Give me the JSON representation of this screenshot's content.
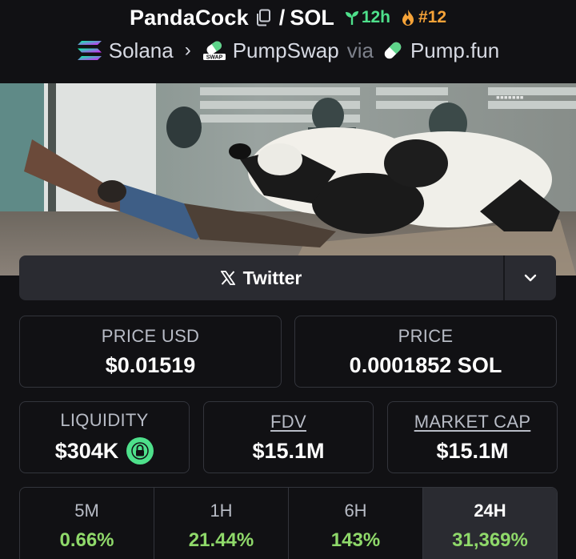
{
  "header": {
    "token_name": "PandaCock",
    "separator": "/",
    "pair": "SOL",
    "age": "12h",
    "rank": "#12",
    "colors": {
      "age": "#4ee08b",
      "rank": "#f6a338"
    },
    "breadcrumb": {
      "chain": "Solana",
      "chain_icon": "solana-icon",
      "dex": "PumpSwap",
      "dex_icon": "pumpswap-icon",
      "dex_icon_text": "SWAP",
      "via": "via",
      "launchpad": "Pump.fun",
      "launchpad_icon": "pill-icon"
    }
  },
  "twitter": {
    "label": "Twitter",
    "icon": "x-logo-icon",
    "dropdown_icon": "chevron-down-icon"
  },
  "stats": {
    "price_usd": {
      "label": "PRICE USD",
      "value": "$0.01519"
    },
    "price": {
      "label": "PRICE",
      "value": "0.0001852 SOL"
    },
    "liquidity": {
      "label": "LIQUIDITY",
      "value": "$304K",
      "icon": "lock-icon"
    },
    "fdv": {
      "label": "FDV",
      "value": "$15.1M"
    },
    "market_cap": {
      "label": "MARKET CAP",
      "value": "$15.1M"
    }
  },
  "changes": [
    {
      "period": "5M",
      "value": "0.66%"
    },
    {
      "period": "1H",
      "value": "21.44%"
    },
    {
      "period": "6H",
      "value": "143%"
    },
    {
      "period": "24H",
      "value": "31,369%",
      "active": true
    }
  ],
  "colors": {
    "background": "#111114",
    "positive": "#8fd96a",
    "card_border": "#33353c"
  }
}
